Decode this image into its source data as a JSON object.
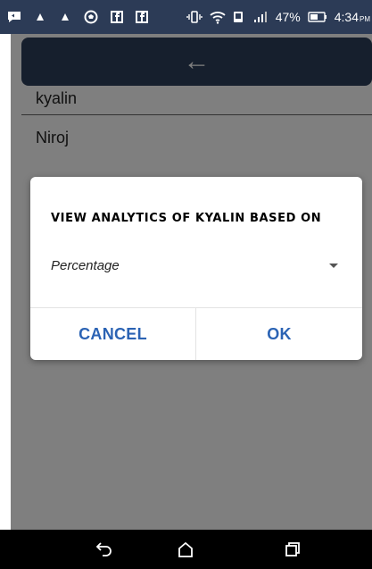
{
  "status_bar": {
    "battery_percent": "47%",
    "time": "4:34",
    "ampm": "PM",
    "icons": [
      "message-icon",
      "warning-icon",
      "warning-icon",
      "soccer-icon",
      "facebook-icon",
      "facebook-icon",
      "vibrate-icon",
      "wifi-icon",
      "nfc-icon",
      "signal-icon",
      "battery-icon"
    ]
  },
  "toolbar": {
    "back_glyph": "←"
  },
  "list": {
    "items": [
      {
        "label": "kyalin"
      },
      {
        "label": "Niroj"
      }
    ]
  },
  "dialog": {
    "title": "VIEW ANALYTICS OF KYALIN BASED ON",
    "select_value": "Percentage",
    "cancel_label": "CANCEL",
    "ok_label": "OK"
  },
  "colors": {
    "toolbar": "#2d3e5b",
    "status_bar": "#2c3b56",
    "button_text": "#2b63b4"
  }
}
